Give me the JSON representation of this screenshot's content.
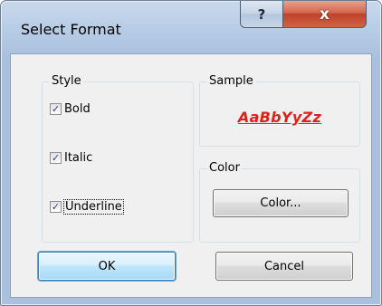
{
  "window": {
    "title": "Select Format",
    "help_glyph": "?",
    "close_glyph": "x"
  },
  "style_group": {
    "label": "Style",
    "options": [
      {
        "label": "Bold",
        "checked": true
      },
      {
        "label": "Italic",
        "checked": true
      },
      {
        "label": "Underline",
        "checked": true
      }
    ]
  },
  "sample_group": {
    "label": "Sample",
    "text": "AaBbYyZz",
    "text_color": "#e0201a"
  },
  "color_group": {
    "label": "Color",
    "button_label": "Color..."
  },
  "buttons": {
    "ok_label": "OK",
    "cancel_label": "Cancel"
  },
  "checkmark_glyph": "✓"
}
